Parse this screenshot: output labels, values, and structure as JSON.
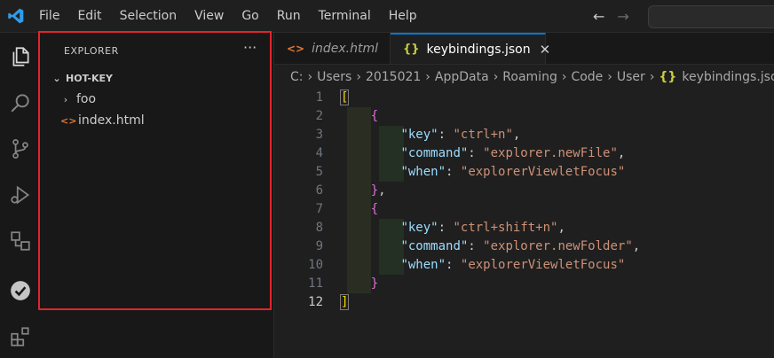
{
  "menu": [
    "File",
    "Edit",
    "Selection",
    "View",
    "Go",
    "Run",
    "Terminal",
    "Help"
  ],
  "nav": {
    "back": "←",
    "forward": "→"
  },
  "activity_icons": [
    "files-icon",
    "search-icon",
    "source-control-icon",
    "run-debug-icon",
    "remote-explorer-icon",
    "testing-icon",
    "extensions-icon"
  ],
  "sidebar": {
    "title": "EXPLORER",
    "more": "···",
    "section": "HOT-KEY",
    "items": [
      {
        "label": "foo",
        "kind": "folder"
      },
      {
        "label": "index.html",
        "kind": "html"
      }
    ]
  },
  "tabs": [
    {
      "label": "index.html",
      "glyph": "<>"
    },
    {
      "label": "keybindings.json",
      "glyph": "{}",
      "close": "✕"
    }
  ],
  "breadcrumb": [
    "C:",
    "Users",
    "2015021",
    "AppData",
    "Roaming",
    "Code",
    "User",
    "keybindings.json",
    "..."
  ],
  "editor": {
    "line_numbers": [
      "1",
      "2",
      "3",
      "4",
      "5",
      "6",
      "7",
      "8",
      "9",
      "10",
      "11",
      "12"
    ],
    "active_line": "12",
    "bindings": [
      {
        "key": "ctrl+n",
        "command": "explorer.newFile",
        "when": "explorerViewletFocus"
      },
      {
        "key": "ctrl+shift+n",
        "command": "explorer.newFolder",
        "when": "explorerViewletFocus"
      }
    ]
  },
  "colors": {
    "accent": "#0078d4",
    "highlight_border": "#e0242f"
  }
}
